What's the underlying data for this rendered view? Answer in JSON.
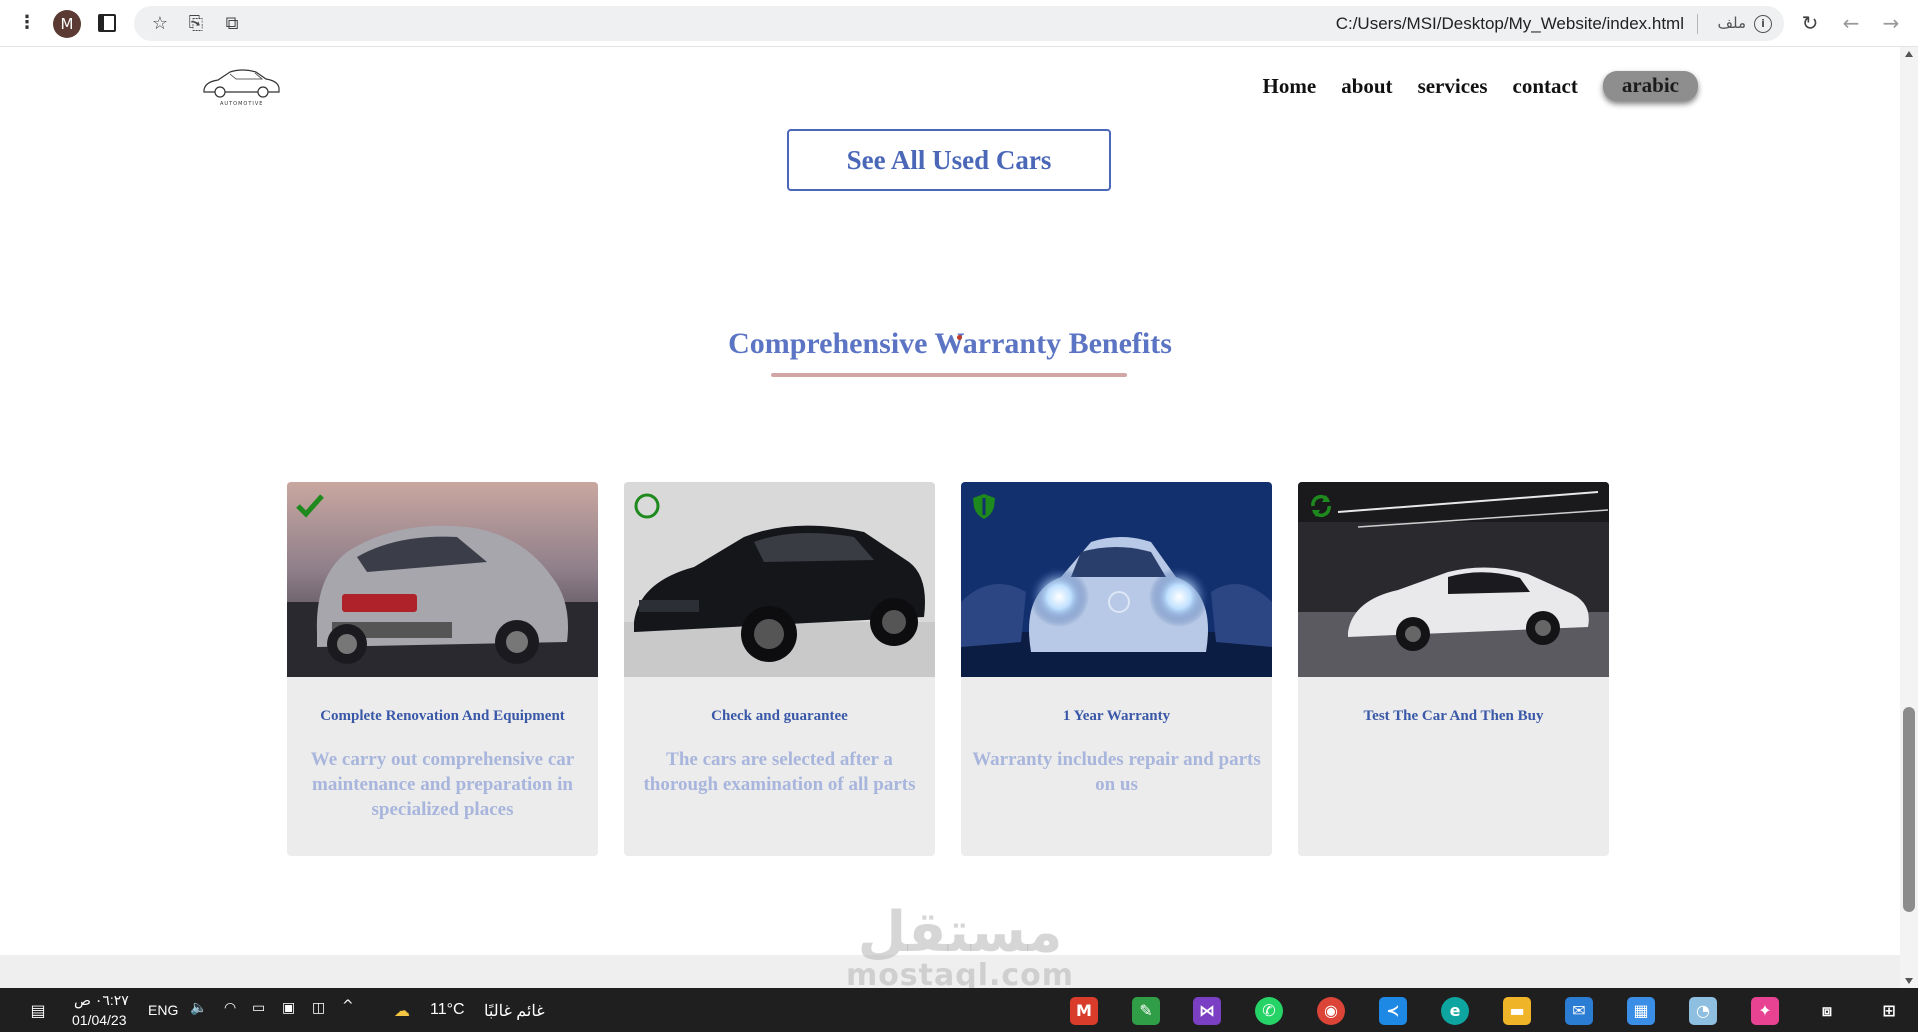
{
  "browser": {
    "avatar_letter": "M",
    "url": "C:/Users/MSI/Desktop/My_Website/index.html",
    "file_label": "ملف",
    "icons": [
      "menu-icon",
      "sidebar-icon",
      "star-icon",
      "share-icon",
      "translate-icon",
      "info-icon",
      "reload-icon",
      "back-icon",
      "forward-icon"
    ]
  },
  "site": {
    "logo_text": "AUTOMOTIVE",
    "nav": {
      "home": "Home",
      "about": "about",
      "services": "services",
      "contact": "contact",
      "language": "arabic"
    },
    "see_all_button": "See All Used Cars",
    "section_title": "Comprehensive Warranty Benefits",
    "cards": [
      {
        "title": "Complete Renovation And Equipment",
        "text": "We carry out comprehensive car maintenance and preparation in specialized places",
        "badge_icon": "check-icon"
      },
      {
        "title": "Check and guarantee",
        "text": "The cars are selected after a thorough examination of all parts",
        "badge_icon": "circle-icon"
      },
      {
        "title": "1 Year Warranty",
        "text": "Warranty includes repair and parts on us",
        "badge_icon": "shield-icon"
      },
      {
        "title": "Test The Car And Then Buy",
        "text": "",
        "badge_icon": "sync-icon"
      }
    ],
    "watermark": {
      "arabic": "مستقل",
      "latin": "mostaql.com"
    }
  },
  "taskbar": {
    "time": "٠٦:٢٧ ص",
    "date": "01/04/23",
    "language": "ENG",
    "weather_temp": "11°C",
    "weather_desc": "غائم غالبًا"
  },
  "colors": {
    "accent_blue": "#5b74c3",
    "button_border": "#4a67b8",
    "card_bg": "#ececec",
    "badge_green": "#1e8a1e",
    "underline": "#d3a6a6"
  }
}
